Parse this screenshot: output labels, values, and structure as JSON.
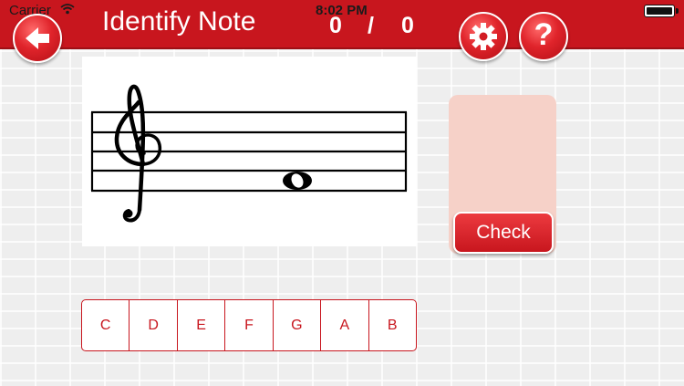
{
  "status_bar": {
    "carrier": "Carrier",
    "time": "8:02 PM"
  },
  "header": {
    "title": "Identify Note",
    "score_correct": "0",
    "score_separator": "/",
    "score_total": "0"
  },
  "icons": {
    "back": "back-arrow-icon",
    "settings": "gear-icon",
    "help": "help-icon",
    "help_glyph": "?"
  },
  "exercise": {
    "clef": "treble",
    "note": "whole note"
  },
  "check_button": {
    "label": "Check"
  },
  "note_buttons": [
    "C",
    "D",
    "E",
    "F",
    "G",
    "A",
    "B"
  ],
  "colors": {
    "accent": "#c8161e",
    "answer_panel": "#f5cfc5"
  }
}
